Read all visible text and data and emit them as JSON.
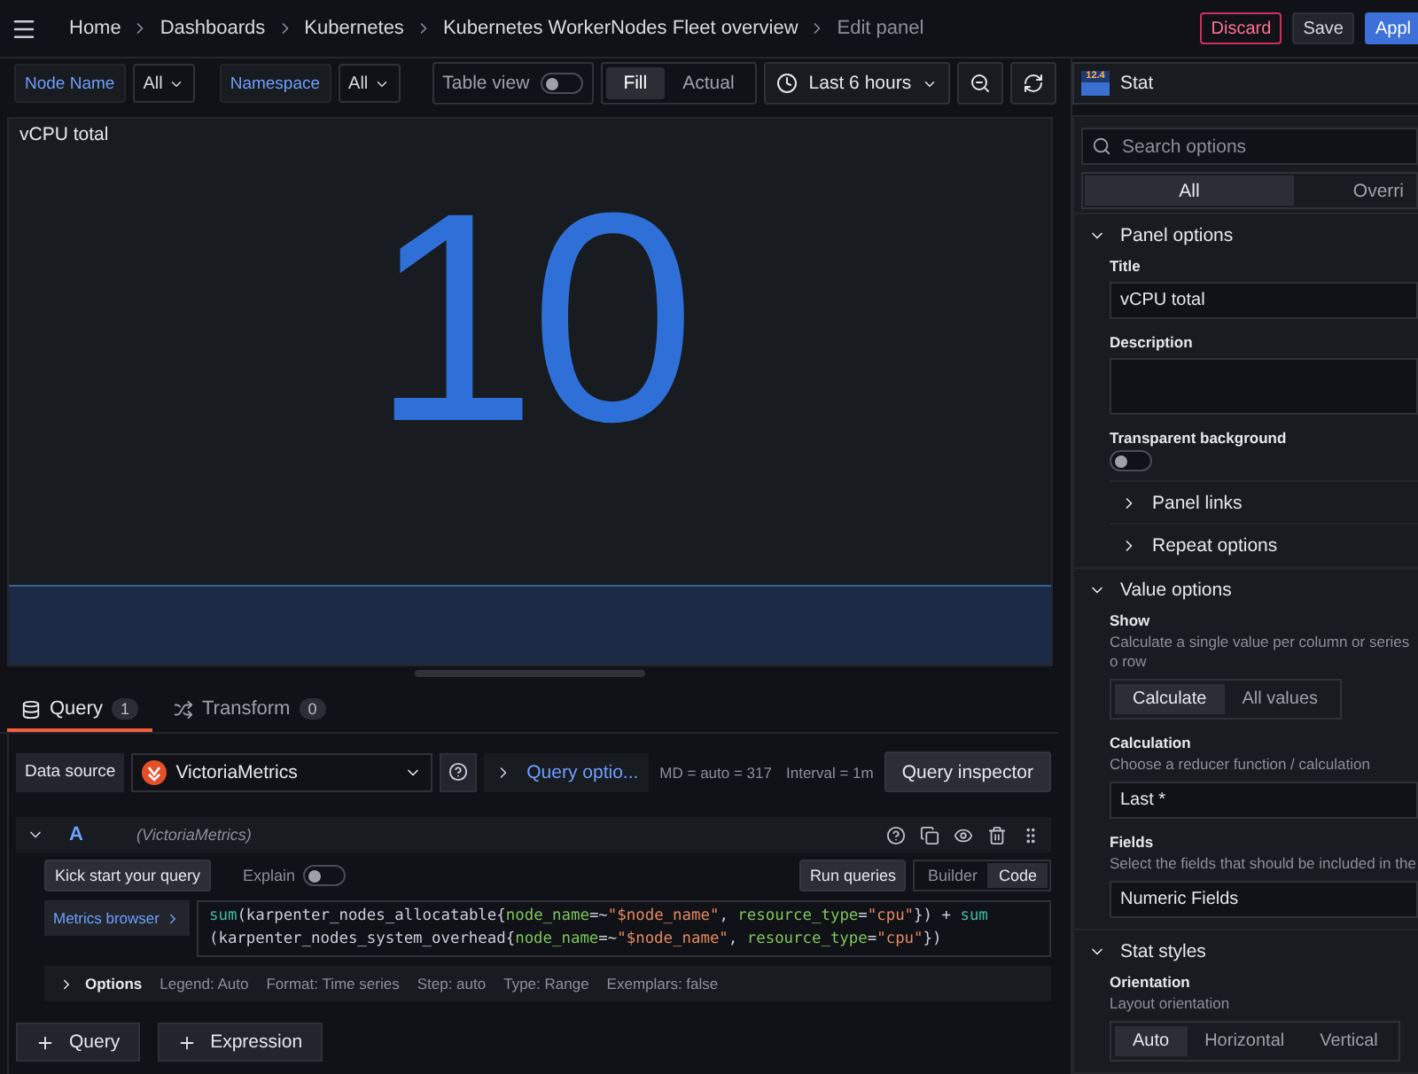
{
  "breadcrumbs": [
    "Home",
    "Dashboards",
    "Kubernetes",
    "Kubernetes WorkerNodes Fleet overview",
    "Edit panel"
  ],
  "header_buttons": [
    {
      "label": "Discard",
      "kind": "danger"
    },
    {
      "label": "Save",
      "kind": "secondary"
    },
    {
      "label": "Appl",
      "kind": "primary"
    }
  ],
  "variables": [
    {
      "label": "Node Name",
      "value": "All"
    },
    {
      "label": "Namespace",
      "value": "All"
    }
  ],
  "table_view": {
    "label": "Table view",
    "on": false
  },
  "fill_mode": [
    {
      "label": "Fill",
      "selected": true
    },
    {
      "label": "Actual",
      "selected": false
    }
  ],
  "time_range": "Last 6 hours",
  "visualization": {
    "icon_text": "12.4",
    "name": "Stat"
  },
  "panel": {
    "title": "vCPU total",
    "value": "10"
  },
  "query_tabs": [
    {
      "label": "Query",
      "count": "1",
      "selected": true
    },
    {
      "label": "Transform",
      "count": "0",
      "selected": false
    }
  ],
  "datasource": {
    "label": "Data source",
    "name": "VictoriaMetrics",
    "query_options": "Query optio...",
    "max_data_points": "MD = auto = 317",
    "interval": "Interval = 1m",
    "inspector": "Query inspector"
  },
  "query": {
    "ref": "A",
    "datasource": "(VictoriaMetrics)",
    "expanded": true,
    "kick_start": "Kick start your query",
    "explain": {
      "label": "Explain",
      "on": false
    },
    "run": "Run queries",
    "modes": [
      {
        "label": "Builder",
        "selected": false
      },
      {
        "label": "Code",
        "selected": true
      }
    ],
    "metrics_browser": "Metrics browser",
    "lines": [
      [
        {
          "text": "sum",
          "kind": "fn"
        },
        {
          "text": "(karpenter_nodes_allocatable{",
          "kind": "plain"
        },
        {
          "text": "node_name",
          "kind": "label"
        },
        {
          "text": "=~",
          "kind": "op"
        },
        {
          "text": "\"$node_name\"",
          "kind": "string"
        },
        {
          "text": ", ",
          "kind": "plain"
        },
        {
          "text": "resource_type",
          "kind": "label"
        },
        {
          "text": "=",
          "kind": "op"
        },
        {
          "text": "\"cpu\"",
          "kind": "string"
        },
        {
          "text": "}) ",
          "kind": "plain"
        },
        {
          "text": "+ ",
          "kind": "op"
        },
        {
          "text": "sum",
          "kind": "fn"
        }
      ],
      [
        {
          "text": "(karpenter_nodes_system_overhead{",
          "kind": "plain"
        },
        {
          "text": "node_name",
          "kind": "label"
        },
        {
          "text": "=~",
          "kind": "op"
        },
        {
          "text": "\"$node_name\"",
          "kind": "string"
        },
        {
          "text": ", ",
          "kind": "plain"
        },
        {
          "text": "resource_type",
          "kind": "label"
        },
        {
          "text": "=",
          "kind": "op"
        },
        {
          "text": "\"cpu\"",
          "kind": "string"
        },
        {
          "text": "})",
          "kind": "plain"
        }
      ]
    ],
    "options_label": "Options",
    "options": [
      "Legend: Auto",
      "Format: Time series",
      "Step: auto",
      "Type: Range",
      "Exemplars: false"
    ]
  },
  "add_buttons": [
    "Query",
    "Expression"
  ],
  "options_pane": {
    "search": {
      "placeholder": "Search options"
    },
    "tabs": [
      {
        "label": "All",
        "selected": true
      },
      {
        "label": "Overri",
        "selected": false
      }
    ],
    "sections": [
      {
        "title": "Panel options",
        "expanded": true,
        "items": [
          {
            "kind": "input",
            "label": "Title",
            "value": "vCPU total"
          },
          {
            "kind": "textarea",
            "label": "Description"
          },
          {
            "kind": "switch",
            "label": "Transparent background",
            "on": false
          },
          {
            "kind": "subsection",
            "title": "Panel links",
            "expanded": false
          },
          {
            "kind": "subsection",
            "title": "Repeat options",
            "expanded": false
          }
        ]
      },
      {
        "title": "Value options",
        "expanded": true,
        "items": [
          {
            "kind": "radio",
            "label": "Show",
            "description": "Calculate a single value per column or series o row",
            "options": [
              {
                "label": "Calculate",
                "selected": true
              },
              {
                "label": "All values",
                "selected": false
              }
            ]
          },
          {
            "kind": "input",
            "label": "Calculation",
            "description": "Choose a reducer function / calculation",
            "value": "Last *"
          },
          {
            "kind": "input",
            "label": "Fields",
            "description": "Select the fields that should be included in the",
            "value": "Numeric Fields"
          }
        ]
      },
      {
        "title": "Stat styles",
        "expanded": true,
        "items": [
          {
            "kind": "radio",
            "label": "Orientation",
            "description": "Layout orientation",
            "options": [
              {
                "label": "Auto",
                "selected": true
              },
              {
                "label": "Horizontal",
                "selected": false
              },
              {
                "label": "Vertical",
                "selected": false
              }
            ]
          }
        ]
      }
    ]
  }
}
